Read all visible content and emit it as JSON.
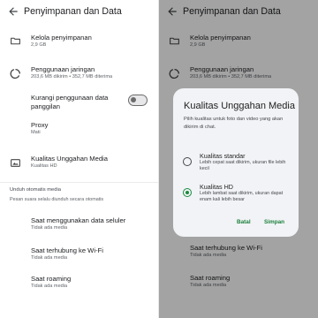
{
  "colors": {
    "accent": "#1a8a3f",
    "button_text": "#1a7f3a",
    "scrim": "rgba(0,0,0,0.36)",
    "dialog_bg": "#f1f3f6"
  },
  "appbar": {
    "title": "Penyimpanan dan Data",
    "back_icon": "arrow-left-icon"
  },
  "settings": {
    "manage_storage": {
      "icon": "folder-icon",
      "title": "Kelola penyimpanan",
      "subtitle": "2,9 GB"
    },
    "network_usage": {
      "icon": "data-usage-icon",
      "title": "Penggunaan jaringan",
      "subtitle": "203,6 MB dikirim • 352,7 MB diterima"
    },
    "reduce_data": {
      "title": "Kurangi penggunaan data panggilan",
      "enabled": false
    },
    "proxy": {
      "title": "Proxy",
      "subtitle": "Mati"
    },
    "media_upload_quality": {
      "icon": "image-quality-icon",
      "title": "Kualitas Unggahan Media",
      "subtitle": "Kualitas HD"
    }
  },
  "auto_download": {
    "header": "Unduh otomatis media",
    "description": "Pesan suara selalu diunduh secara otomatis",
    "items": [
      {
        "title": "Saat menggunakan data seluler",
        "subtitle": "Tidak ada media"
      },
      {
        "title": "Saat terhubung ke Wi-Fi",
        "subtitle": "Tidak ada media"
      },
      {
        "title": "Saat roaming",
        "subtitle": "Tidak ada media"
      }
    ]
  },
  "dialog": {
    "title": "Kualitas Unggahan Media",
    "description": "Pilih kualitas untuk foto dan video yang akan dikirim di chat.",
    "options": [
      {
        "title": "Kualitas standar",
        "subtitle": "Lebih cepat saat dikirim, ukuran file lebih kecil",
        "selected": false
      },
      {
        "title": "Kualitas HD",
        "subtitle": "Lebih lambat saat dikirim, ukuran dapat enam kali lebih besar",
        "selected": true
      }
    ],
    "cancel_label": "Batal",
    "save_label": "Simpan"
  }
}
